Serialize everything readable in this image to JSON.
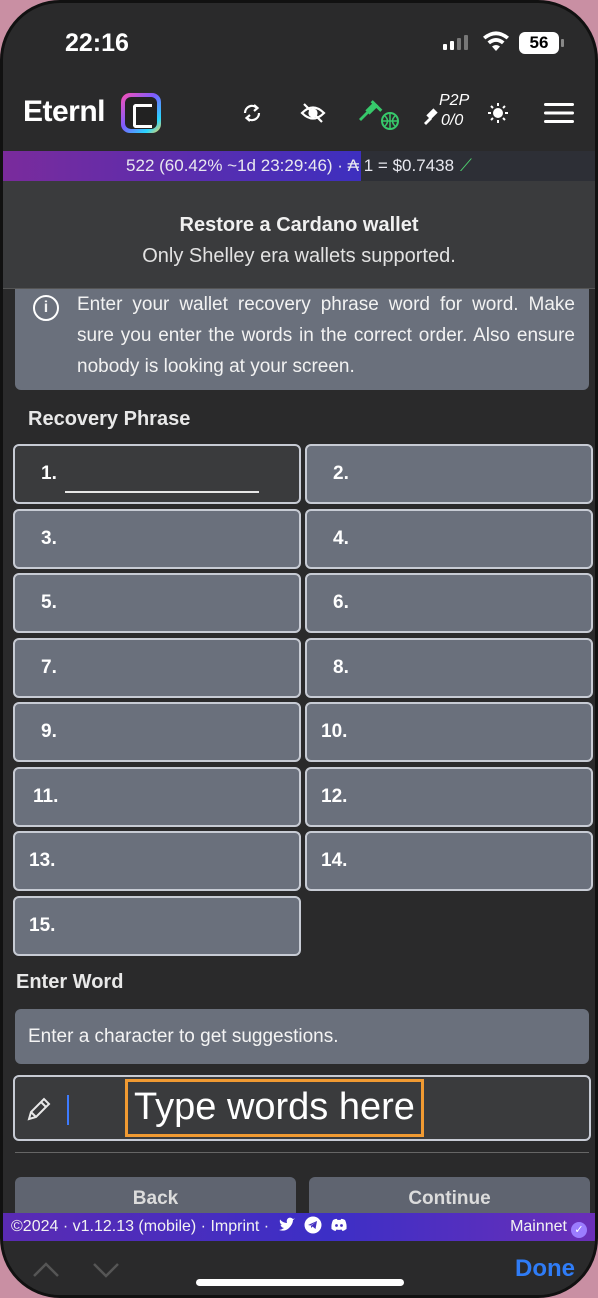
{
  "status_bar": {
    "time": "22:16",
    "battery": "56"
  },
  "header": {
    "app_name": "Eternl",
    "icons": [
      "sync-icon",
      "eye-off-icon",
      "plug-globe-icon",
      "plug-off-icon",
      "brightness-icon",
      "menu-icon"
    ],
    "p2p_label": "P2P",
    "p2p_count": "0/0",
    "accent_color": "#37c96b"
  },
  "sync_bar": {
    "text": "522 (60.42%  ~1d 23:29:46) · ₳ 1 = $0.7438",
    "progress": 0.6042,
    "trend_icon": "trend-up-icon"
  },
  "dialog": {
    "title": "Restore a Cardano wallet",
    "subtitle": "Only Shelley era wallets supported."
  },
  "info": {
    "text": "Enter your wallet recovery phrase word for word. Make sure you enter the words in the correct order. Also ensure nobody is looking at your screen."
  },
  "recovery": {
    "label": "Recovery Phrase",
    "words": [
      "1.",
      "2.",
      "3.",
      "4.",
      "5.",
      "6.",
      "7.",
      "8.",
      "9.",
      "10.",
      "11.",
      "12.",
      "13.",
      "14.",
      "15."
    ]
  },
  "enter_word": {
    "label": "Enter Word",
    "hint": "Enter a character to get suggestions.",
    "placeholder": "Type words here"
  },
  "buttons": {
    "back": "Back",
    "continue": "Continue"
  },
  "footer": {
    "left": "©2024 · v1.12.13 (mobile) · Imprint ·",
    "network": "Mainnet"
  },
  "accessory": {
    "done": "Done"
  }
}
